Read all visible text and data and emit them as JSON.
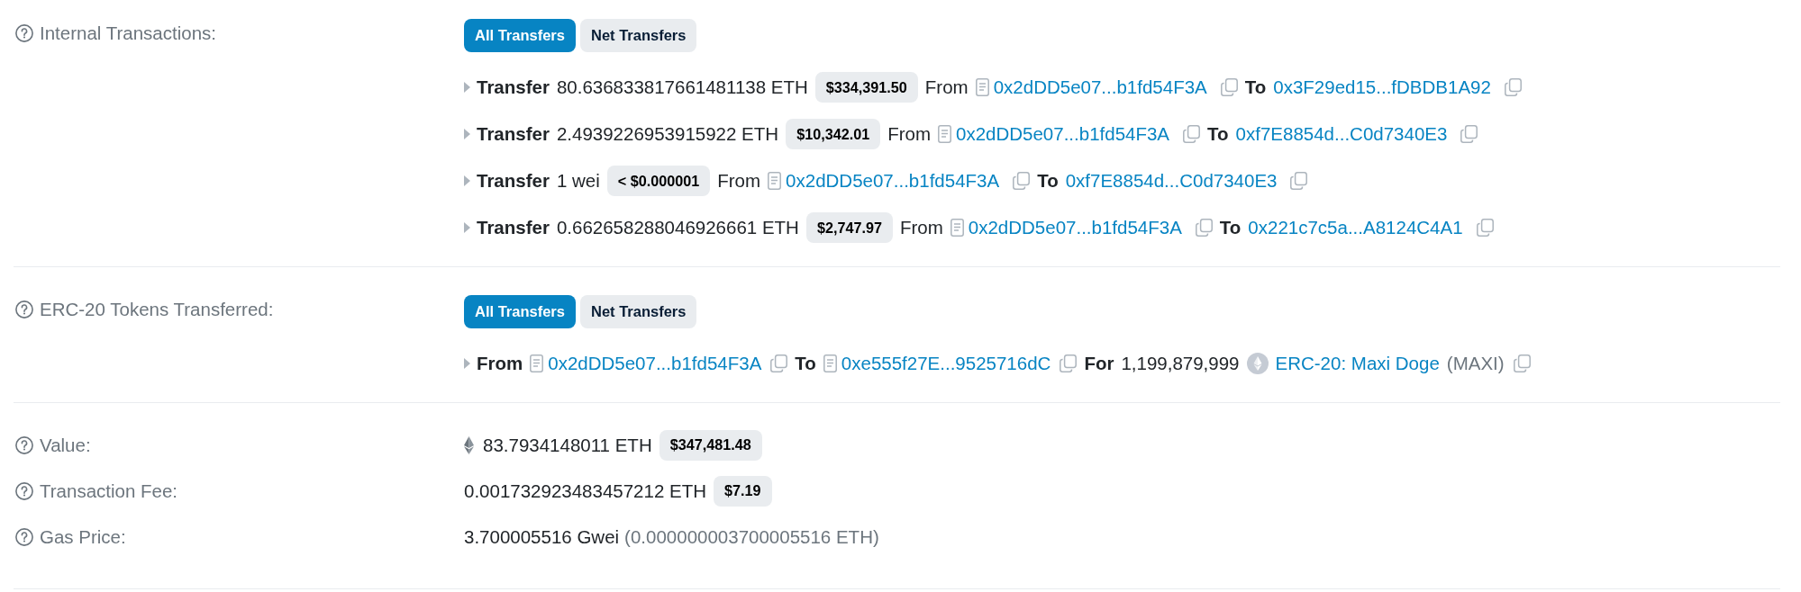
{
  "sections": [
    {
      "kind": "transfers",
      "label": "Internal Transactions:",
      "toggle": [
        {
          "label": "All Transfers",
          "selected": true
        },
        {
          "label": "Net Transfers",
          "selected": false
        }
      ],
      "rows": [
        {
          "kind": "internal",
          "expanded": false,
          "action": "Transfer",
          "amount": "80.636833817661481138 ETH",
          "usd": "$334,391.50",
          "from_label": "From",
          "from": {
            "kind": "contract",
            "address": "0x2dDD5e07...b1fd54F3A"
          },
          "to_label": "To",
          "to": {
            "kind": "wallet",
            "address": "0x3F29ed15...fDBDB1A92"
          }
        },
        {
          "kind": "internal",
          "expanded": false,
          "action": "Transfer",
          "amount": "2.4939226953915922 ETH",
          "usd": "$10,342.01",
          "from_label": "From",
          "from": {
            "kind": "contract",
            "address": "0x2dDD5e07...b1fd54F3A"
          },
          "to_label": "To",
          "to": {
            "kind": "wallet",
            "address": "0xf7E8854d...C0d7340E3"
          }
        },
        {
          "kind": "internal",
          "expanded": false,
          "action": "Transfer",
          "amount": "1 wei",
          "usd": "< $0.000001",
          "from_label": "From",
          "from": {
            "kind": "contract",
            "address": "0x2dDD5e07...b1fd54F3A"
          },
          "to_label": "To",
          "to": {
            "kind": "wallet",
            "address": "0xf7E8854d...C0d7340E3"
          }
        },
        {
          "kind": "internal",
          "expanded": false,
          "action": "Transfer",
          "amount": "0.662658288046926661 ETH",
          "usd": "$2,747.97",
          "from_label": "From",
          "from": {
            "kind": "contract",
            "address": "0x2dDD5e07...b1fd54F3A"
          },
          "to_label": "To",
          "to": {
            "kind": "wallet",
            "address": "0x221c7c5a...A8124C4A1"
          }
        }
      ]
    },
    {
      "kind": "transfers",
      "label": "ERC-20 Tokens Transferred:",
      "toggle": [
        {
          "label": "All Transfers",
          "selected": true
        },
        {
          "label": "Net Transfers",
          "selected": false
        }
      ],
      "rows": [
        {
          "kind": "token",
          "expanded": false,
          "from_label": "From",
          "from": {
            "kind": "contract",
            "address": "0x2dDD5e07...b1fd54F3A"
          },
          "to_label": "To",
          "to": {
            "kind": "contract",
            "address": "0xe555f27E...9525716dC"
          },
          "for_label": "For",
          "amount": "1,199,879,999",
          "token": "ERC-20: Maxi Doge",
          "symbol": "(MAXI)"
        }
      ]
    },
    {
      "kind": "fields",
      "rows": [
        {
          "kind": "eth_value",
          "label": "Value:",
          "amount": "83.7934148011 ETH",
          "usd": "$347,481.48"
        },
        {
          "kind": "plain",
          "label": "Transaction Fee:",
          "amount": "0.001732923483457212 ETH",
          "usd": "$7.19"
        },
        {
          "kind": "plain",
          "label": "Gas Price:",
          "amount": "3.700005516 Gwei",
          "note": "(0.000000003700005516 ETH)"
        }
      ]
    }
  ]
}
